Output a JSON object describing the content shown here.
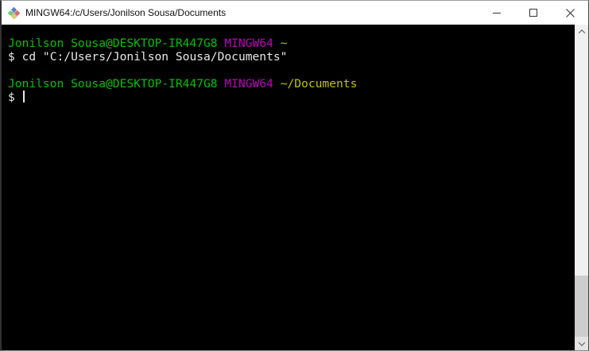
{
  "window": {
    "title": "MINGW64:/c/Users/Jonilson Sousa/Documents",
    "app_icon": "git-bash-msys-diamond-icon",
    "controls": {
      "minimize": "Minimize",
      "maximize": "Maximize",
      "close": "Close"
    }
  },
  "terminal": {
    "palette": {
      "background": "#000000",
      "foreground": "#e8e8e8",
      "green": "#00c200",
      "magenta": "#c000c0",
      "yellow": "#c0c000"
    },
    "cursor": {
      "visible": true,
      "style": "bar",
      "color": "#e8e8e8"
    },
    "lines": [
      {
        "segments": [
          {
            "text": "Jonilson Sousa@DESKTOP-IR447G8",
            "color": "green"
          },
          {
            "text": " ",
            "color": "foreground"
          },
          {
            "text": "MINGW64",
            "color": "magenta"
          },
          {
            "text": " ",
            "color": "foreground"
          },
          {
            "text": "~",
            "color": "yellow"
          }
        ]
      },
      {
        "segments": [
          {
            "text": "$ cd \"C:/Users/Jonilson Sousa/Documents\"",
            "color": "foreground"
          }
        ]
      },
      {
        "segments": []
      },
      {
        "segments": [
          {
            "text": "Jonilson Sousa@DESKTOP-IR447G8",
            "color": "green"
          },
          {
            "text": " ",
            "color": "foreground"
          },
          {
            "text": "MINGW64",
            "color": "magenta"
          },
          {
            "text": " ",
            "color": "foreground"
          },
          {
            "text": "~/Documents",
            "color": "yellow"
          }
        ]
      },
      {
        "segments": [
          {
            "text": "$ ",
            "color": "foreground"
          }
        ],
        "cursor": true
      }
    ]
  },
  "scrollbar": {
    "track_color": "#f0f0f0",
    "thumb_color": "#cdcdcd",
    "up_icon": "chevron-up",
    "down_icon": "chevron-down"
  }
}
